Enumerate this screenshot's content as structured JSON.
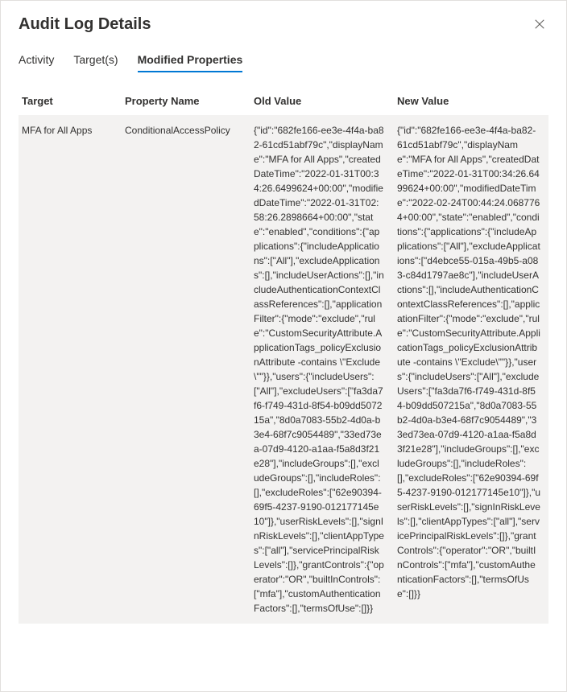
{
  "header": {
    "title": "Audit Log Details"
  },
  "tabs": {
    "activity": "Activity",
    "targets": "Target(s)",
    "modified": "Modified Properties"
  },
  "columns": {
    "target": "Target",
    "propertyName": "Property Name",
    "oldValue": "Old Value",
    "newValue": "New Value"
  },
  "row": {
    "target": "MFA for All Apps",
    "propertyName": "ConditionalAccessPolicy",
    "oldValue": "{\"id\":\"682fe166-ee3e-4f4a-ba82-61cd51abf79c\",\"displayName\":\"MFA for All Apps\",\"createdDateTime\":\"2022-01-31T00:34:26.6499624+00:00\",\"modifiedDateTime\":\"2022-01-31T02:58:26.2898664+00:00\",\"state\":\"enabled\",\"conditions\":{\"applications\":{\"includeApplications\":[\"All\"],\"excludeApplications\":[],\"includeUserActions\":[],\"includeAuthenticationContextClassReferences\":[],\"applicationFilter\":{\"mode\":\"exclude\",\"rule\":\"CustomSecurityAttribute.ApplicationTags_policyExclusionAttribute -contains \\\"Exclude\\\"\"}},\"users\":{\"includeUsers\":[\"All\"],\"excludeUsers\":[\"fa3da7f6-f749-431d-8f54-b09dd507215a\",\"8d0a7083-55b2-4d0a-b3e4-68f7c9054489\",\"33ed73ea-07d9-4120-a1aa-f5a8d3f21e28\"],\"includeGroups\":[],\"excludeGroups\":[],\"includeRoles\":[],\"excludeRoles\":[\"62e90394-69f5-4237-9190-012177145e10\"]},\"userRiskLevels\":[],\"signInRiskLevels\":[],\"clientAppTypes\":[\"all\"],\"servicePrincipalRiskLevels\":[]},\"grantControls\":{\"operator\":\"OR\",\"builtInControls\":[\"mfa\"],\"customAuthenticationFactors\":[],\"termsOfUse\":[]}}",
    "newValue": "{\"id\":\"682fe166-ee3e-4f4a-ba82-61cd51abf79c\",\"displayName\":\"MFA for All Apps\",\"createdDateTime\":\"2022-01-31T00:34:26.6499624+00:00\",\"modifiedDateTime\":\"2022-02-24T00:44:24.0687764+00:00\",\"state\":\"enabled\",\"conditions\":{\"applications\":{\"includeApplications\":[\"All\"],\"excludeApplications\":[\"d4ebce55-015a-49b5-a083-c84d1797ae8c\"],\"includeUserActions\":[],\"includeAuthenticationContextClassReferences\":[],\"applicationFilter\":{\"mode\":\"exclude\",\"rule\":\"CustomSecurityAttribute.ApplicationTags_policyExclusionAttribute -contains \\\"Exclude\\\"\"}},\"users\":{\"includeUsers\":[\"All\"],\"excludeUsers\":[\"fa3da7f6-f749-431d-8f54-b09dd507215a\",\"8d0a7083-55b2-4d0a-b3e4-68f7c9054489\",\"33ed73ea-07d9-4120-a1aa-f5a8d3f21e28\"],\"includeGroups\":[],\"excludeGroups\":[],\"includeRoles\":[],\"excludeRoles\":[\"62e90394-69f5-4237-9190-012177145e10\"]},\"userRiskLevels\":[],\"signInRiskLevels\":[],\"clientAppTypes\":[\"all\"],\"servicePrincipalRiskLevels\":[]},\"grantControls\":{\"operator\":\"OR\",\"builtInControls\":[\"mfa\"],\"customAuthenticationFactors\":[],\"termsOfUse\":[]}}"
  }
}
